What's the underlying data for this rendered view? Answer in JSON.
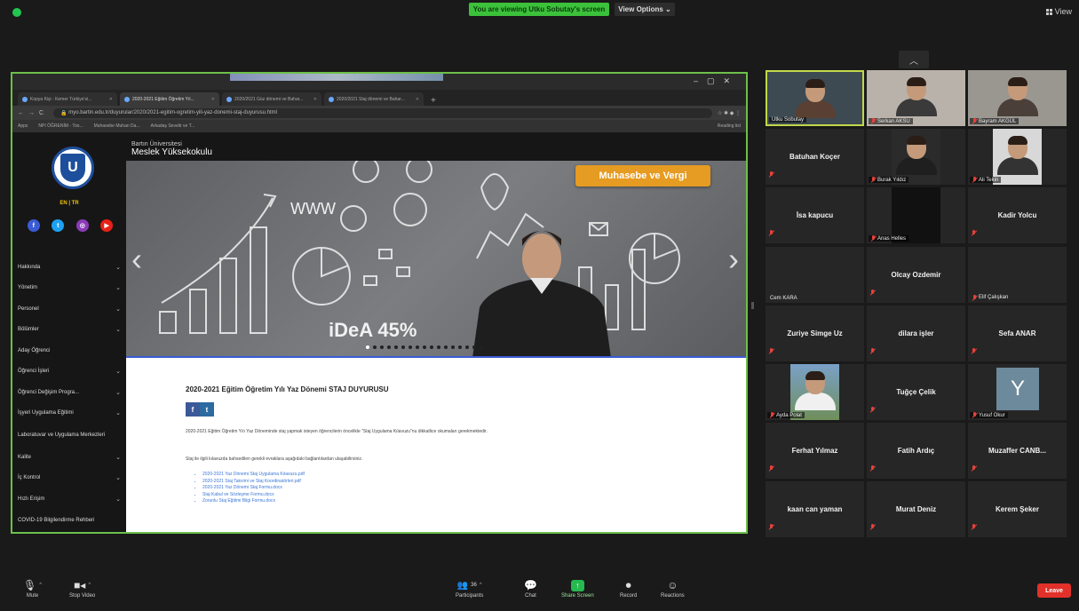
{
  "topbar": {
    "sharing_label": "You are viewing Utku Sobutay's screen",
    "view_options_label": "View Options",
    "view_label": "View"
  },
  "browser": {
    "tabs": [
      {
        "label": "Kopya Kişi - Kemer Türkiye'si..."
      },
      {
        "label": "2020-2021 Eğitim Öğretim Yıl..."
      },
      {
        "label": "2020/2021 Güz dönemi ve Bahar..."
      },
      {
        "label": "2020/2021 Staj dönemi ve Bahar..."
      }
    ],
    "url": "myo.bartin.edu.tr/duyurular/2020/2021-egitim-ogretim-yili-yaz-donemi-staj-duyurusu.html",
    "bookmarks": [
      "Apps",
      "NPI ÖĞRENİM - Too...",
      "Muhasebe Muhan Da...",
      "Arkadaş Sevelir ve T..."
    ],
    "reading_list": "Reading list"
  },
  "site": {
    "university": "Bartın Üniversitesi",
    "school": "Meslek Yüksekokulu",
    "lang": "EN  |  TR",
    "menu": [
      {
        "label": "Hakkında",
        "chevron": true
      },
      {
        "label": "Yönetim",
        "chevron": true
      },
      {
        "label": "Personel",
        "chevron": true
      },
      {
        "label": "Bölümler",
        "chevron": true
      },
      {
        "label": "Aday Öğrenci",
        "chevron": false
      },
      {
        "label": "Öğrenci İşleri",
        "chevron": true
      },
      {
        "label": "Öğrenci Değişim Progra...",
        "chevron": true
      },
      {
        "label": "İşyeri Uygulama Eğitimi",
        "chevron": true
      },
      {
        "label": "Laboratuvar ve Uygulama Merkezleri",
        "chevron": false
      },
      {
        "label": "Kalite",
        "chevron": true
      },
      {
        "label": "İç Kontrol",
        "chevron": true
      },
      {
        "label": "Hızlı Erişim",
        "chevron": true
      },
      {
        "label": "COVID-19 Bilgilendirme Rehberi",
        "chevron": false
      }
    ],
    "slider_badge": "Muhasebe ve Vergi",
    "slider_text_www": "WWW",
    "slider_text_idea": "iDeA 45%",
    "content_title": "2020-2021 Eğitim Öğretim Yılı Yaz Dönemi STAJ DUYURUSU",
    "content_paragraph": "2020-2021 Eğitim Öğretim Yılı Yaz Döneminde staj yapmak isteyen öğrencilerin öncelikle \"Staj Uygulama Kılavuzu\"nu dikkatlice okumaları gerekmektedir.",
    "content_paragraph2": "Staj ile ilgili kılavuzda bahsedilen gerekli evraklara aşağıdaki bağlantılardan ulaşabilirsiniz.",
    "content_links": [
      "2020-2021 Yaz Dönemi Staj Uygulama Kılavuzu.pdf",
      "2020-2021 Staj Takvimi ve Staj Koordinatörleri.pdf",
      "2020-2021 Yaz Dönemi Staj Formu.docx",
      "Staj Kabul ve Sözleşme Formu.docx",
      "Zorunlu Staj Eğitimi Bilgi Formu.docx"
    ]
  },
  "participants": [
    {
      "name": "Utku Sobutay",
      "type": "video",
      "speaker": true,
      "muted": false
    },
    {
      "name": "Serkan AKSU",
      "type": "video",
      "speaker": false,
      "muted": true
    },
    {
      "name": "Bayram AKGÜL",
      "type": "video",
      "speaker": false,
      "muted": true
    },
    {
      "name": "Batuhan Koçer",
      "type": "name",
      "muted": true
    },
    {
      "name": "Burak Yıldız",
      "type": "video",
      "muted": true
    },
    {
      "name": "Ali Tekin",
      "type": "video",
      "muted": true
    },
    {
      "name": "İsa kapucu",
      "type": "name",
      "muted": true
    },
    {
      "name": "Anas Helles",
      "type": "video-dark",
      "muted": true
    },
    {
      "name": "Kadir Yolcu",
      "type": "name",
      "muted": true
    },
    {
      "name": "Cem KARA",
      "type": "caption-only",
      "muted": false
    },
    {
      "name": "Olcay Ozdemir",
      "type": "name",
      "muted": true
    },
    {
      "name": "Elif Çalışkan",
      "type": "caption-only",
      "muted": true
    },
    {
      "name": "Zuriye Simge Uz",
      "type": "name",
      "muted": true
    },
    {
      "name": "dilara işler",
      "type": "name",
      "muted": true
    },
    {
      "name": "Sefa ANAR",
      "type": "name",
      "muted": true
    },
    {
      "name": "Ayda Polat",
      "type": "video-outdoor",
      "muted": true
    },
    {
      "name": "Tuğçe Çelik",
      "type": "name",
      "muted": true
    },
    {
      "name": "Yusuf Okur",
      "type": "avatar",
      "avatar_letter": "Y",
      "muted": true
    },
    {
      "name": "Ferhat Yılmaz",
      "type": "name",
      "muted": true
    },
    {
      "name": "Fatih Ardıç",
      "type": "name",
      "muted": true
    },
    {
      "name": "Muzaffer CANB...",
      "type": "name",
      "muted": true
    },
    {
      "name": "kaan can yaman",
      "type": "name",
      "muted": true
    },
    {
      "name": "Murat Deniz",
      "type": "name",
      "muted": true
    },
    {
      "name": "Kerem Şeker",
      "type": "name",
      "muted": true
    }
  ],
  "toolbar": {
    "mute_label": "Mute",
    "stop_video_label": "Stop Video",
    "participants_label": "Participants",
    "participants_count": "36",
    "chat_label": "Chat",
    "share_screen_label": "Share Screen",
    "record_label": "Record",
    "reactions_label": "Reactions",
    "leave_label": "Leave"
  }
}
